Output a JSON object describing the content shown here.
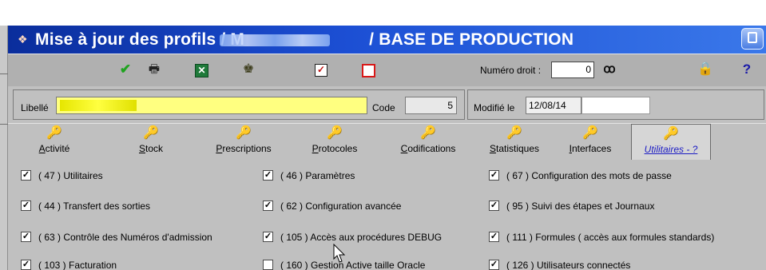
{
  "window": {
    "title": "Mise à jour des profils / M",
    "title_blurred": "",
    "title_suffix": " / BASE DE PRODUCTION"
  },
  "toolbar": {
    "ok_icon": "check-icon",
    "print_icon": "printer-icon",
    "excel_icon": "excel-icon",
    "person_icon": "user-icon",
    "check_all_icon": "checkbox-checked-icon",
    "uncheck_all_icon": "checkbox-empty-icon",
    "numero_droit_label": "Numéro droit :",
    "numero_droit_value": "0",
    "search_icon": "binoculars-icon",
    "lock_icon": "lock-icon",
    "help_label": "?"
  },
  "form": {
    "libelle_label": "Libellé",
    "libelle_value": "",
    "code_label": "Code",
    "code_value": "5",
    "modifie_label": "Modifié le",
    "modifie_date": "12/08/14",
    "modifie_user": ""
  },
  "tabs": [
    {
      "label": "Activité",
      "icon": "key-icon"
    },
    {
      "label": "Stock",
      "icon": "key-icon"
    },
    {
      "label": "Prescriptions",
      "icon": "key-icon"
    },
    {
      "label": "Protocoles",
      "icon": "key-icon"
    },
    {
      "label": "Codifications",
      "icon": "key-icon"
    },
    {
      "label": "Statistiques",
      "icon": "key-icon"
    },
    {
      "label": "Interfaces",
      "icon": "key-icon"
    },
    {
      "label": "Utilitaires - ?",
      "icon": "key-icon",
      "active": true
    }
  ],
  "permissions": [
    {
      "label": "( 47 ) Utilitaires",
      "checked": true
    },
    {
      "label": "( 46 ) Paramètres",
      "checked": true
    },
    {
      "label": "( 67 ) Configuration des mots de passe",
      "checked": true
    },
    {
      "label": "( 44 ) Transfert des sorties",
      "checked": true
    },
    {
      "label": "( 62 ) Configuration avancée",
      "checked": true
    },
    {
      "label": "( 95 ) Suivi des étapes et Journaux",
      "checked": true
    },
    {
      "label": "( 63 ) Contrôle des Numéros d'admission",
      "checked": true
    },
    {
      "label": "( 105 ) Accès aux procédures DEBUG",
      "checked": true
    },
    {
      "label": "( 111 ) Formules ( accès aux formules standards)",
      "checked": true
    },
    {
      "label": "( 103 ) Facturation",
      "checked": true
    },
    {
      "label": "( 160 ) Gestion Active taille Oracle",
      "checked": false
    },
    {
      "label": "( 126 ) Utilisateurs connectés",
      "checked": true
    }
  ],
  "colors": {
    "titlebar_start": "#0a2d9c",
    "titlebar_end": "#3a78ea",
    "panel": "#c0c0c0",
    "toolbar": "#b0b0b0",
    "libelle_field": "#ffff80",
    "active_tab_text": "#1c1cc4"
  }
}
